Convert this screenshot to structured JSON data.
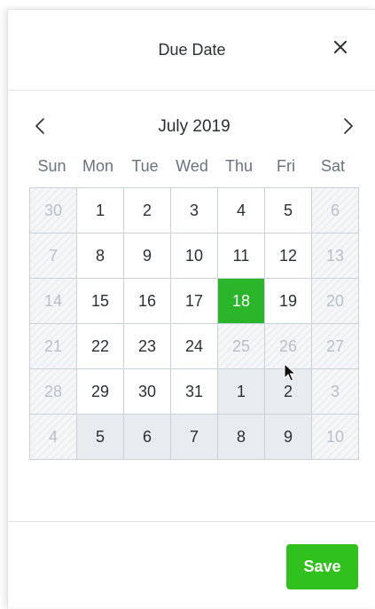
{
  "header": {
    "title": "Due Date"
  },
  "calendar": {
    "month_label": "July 2019",
    "weekdays": [
      "Sun",
      "Mon",
      "Tue",
      "Wed",
      "Thu",
      "Fri",
      "Sat"
    ],
    "weeks": [
      [
        "30",
        "1",
        "2",
        "3",
        "4",
        "5",
        "6"
      ],
      [
        "7",
        "8",
        "9",
        "10",
        "11",
        "12",
        "13"
      ],
      [
        "14",
        "15",
        "16",
        "17",
        "18",
        "19",
        "20"
      ],
      [
        "21",
        "22",
        "23",
        "24",
        "25",
        "26",
        "27"
      ],
      [
        "28",
        "29",
        "30",
        "31",
        "1",
        "2",
        "3"
      ],
      [
        "4",
        "5",
        "6",
        "7",
        "8",
        "9",
        "10"
      ]
    ],
    "selected_day": "18"
  },
  "footer": {
    "save_label": "Save"
  },
  "colors": {
    "selected": "#2bb52b",
    "save_button": "#31c11c",
    "muted_text": "#b9bfc6",
    "next_month_bg": "#e9ecef"
  },
  "icons": {
    "close": "close-icon",
    "prev": "chevron-left-icon",
    "next": "chevron-right-icon",
    "cursor": "mouse-pointer-icon"
  }
}
